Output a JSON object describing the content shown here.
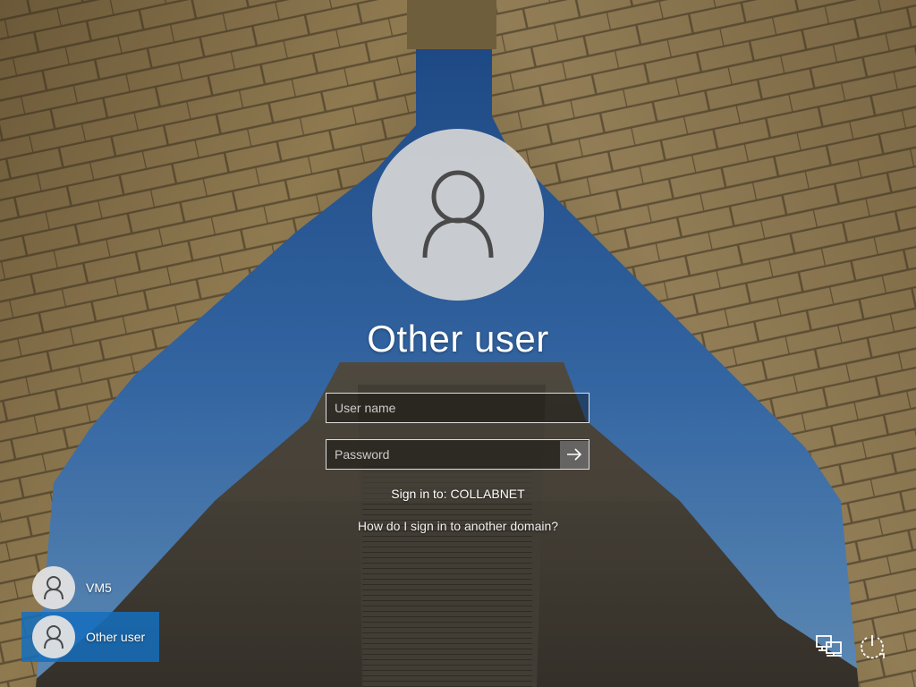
{
  "login": {
    "account_name": "Other user",
    "username_placeholder": "User name",
    "password_placeholder": "Password",
    "signin_to": "Sign in to: COLLABNET",
    "domain_help_link": "How do I sign in to another domain?"
  },
  "user_tiles": [
    {
      "label": "VM5",
      "selected": false,
      "icon": "user-icon"
    },
    {
      "label": "Other user",
      "selected": true,
      "icon": "user-icon"
    }
  ],
  "corner_icons": {
    "network": "network-icon",
    "power": "power-icon",
    "submit": "arrow-right-icon"
  },
  "colors": {
    "selected_tile": "#146ebe",
    "sky": "#2d63a8",
    "stone": "#a08a5e"
  }
}
